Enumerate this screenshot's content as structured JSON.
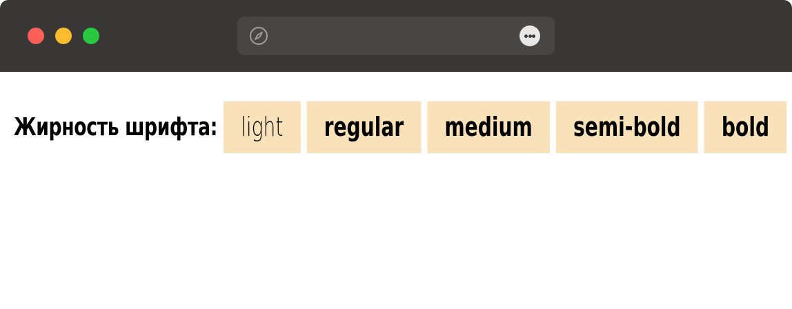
{
  "window": {
    "traffic_lights": {
      "close_color": "#ff5f57",
      "minimize_color": "#febc2e",
      "maximize_color": "#28c840"
    },
    "address_bar": {
      "left_icon": "compass-icon",
      "right_icon": "more-icon"
    }
  },
  "page": {
    "label": "Жирность шрифта:",
    "chips": [
      {
        "text": "light"
      },
      {
        "text": "regular"
      },
      {
        "text": "medium"
      },
      {
        "text": "semi-bold"
      },
      {
        "text": "bold"
      }
    ],
    "chip_background": "#f9e2b9"
  }
}
